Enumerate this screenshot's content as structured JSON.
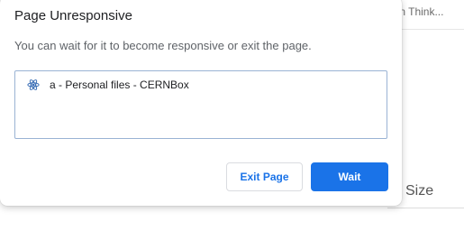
{
  "background": {
    "header_text": "sign Think...",
    "size_header": "Size"
  },
  "dialog": {
    "title": "Page Unresponsive",
    "message": "You can wait for it to become responsive or exit the page.",
    "pages": [
      {
        "icon": "atom-favicon-icon",
        "label": "a - Personal files - CERNBox"
      }
    ],
    "buttons": {
      "exit_label": "Exit Page",
      "wait_label": "Wait"
    }
  },
  "colors": {
    "accent": "#1a73e8",
    "list_border": "#9ab3d4",
    "favicon": "#3b6fb6"
  }
}
